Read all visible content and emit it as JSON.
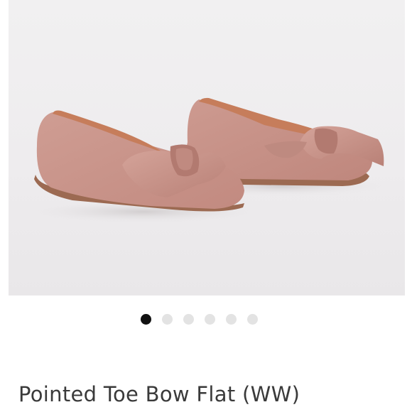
{
  "product": {
    "title": "Pointed Toe Bow Flat (WW)",
    "image_alt": "Blush suede ballet flats with knotted bow"
  },
  "carousel": {
    "total": 6,
    "active_index": 0
  },
  "colors": {
    "suede": "#c9958b",
    "lining": "#c9825f",
    "background": "#efedef",
    "dot_active": "#111111",
    "dot_inactive": "#e3e3e3",
    "title_text": "#3a3a3a"
  }
}
